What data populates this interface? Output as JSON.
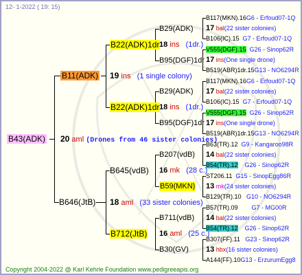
{
  "date_line": "12-   1-2022 (  19:  15)",
  "root": {
    "label": "B43(ADK)",
    "count": "20",
    "unit": "aml",
    "note": "(Drones from 46 sister colonies)"
  },
  "l1_top": {
    "label": "B11(ADK)",
    "count": "19",
    "unit": "ins",
    "note": "(1 single colony)"
  },
  "l1_bot": {
    "label": "B646(JtB)",
    "count": "18",
    "unit": "aml",
    "note": "(33 sister colonies)"
  },
  "l2": [
    {
      "label": "B22(ADK)1dr",
      "count": "18",
      "unit": "ins",
      "note": "(1dr.)"
    },
    {
      "label": "B22(ADK)1dr",
      "count": "18",
      "unit": "ins",
      "note": "(1dr.)"
    },
    {
      "label": "B645(vdB)",
      "count": "16",
      "unit": "mk",
      "note": "(28 c.)"
    },
    {
      "label": "B712(JtB)",
      "count": "16",
      "unit": "aml",
      "note": "(25 c.)"
    }
  ],
  "l3": [
    {
      "label": "B29(ADK)"
    },
    {
      "label": "B95(DGF)1dr"
    },
    {
      "label": "B29(ADK)"
    },
    {
      "label": "B95(DGF)1dr"
    },
    {
      "label": "B207(vdB)"
    },
    {
      "label": "B59(MKN)"
    },
    {
      "label": "B711(vdB)"
    },
    {
      "label": "B30(GV)"
    }
  ],
  "l4": [
    {
      "name": "B117(MKN).16",
      "code": "G6 - Erfoud07-1Q"
    },
    {
      "count": "17",
      "unit": "bal",
      "note": "(22 sister colonies)"
    },
    {
      "name": "B106(IC).15",
      "code": "G7 - Erfoud07-1Q"
    },
    {
      "name": "V555(DGF).15",
      "code": "G26 - Sinop62R"
    },
    {
      "count": "17",
      "unit": "ins",
      "note": "(One single drone)"
    },
    {
      "name": "B519(ABR)1dr.15",
      "code": "G13 - NO6294R"
    },
    {
      "name": "B117(MKN).16",
      "code": "G6 - Erfoud07-1Q"
    },
    {
      "count": "17",
      "unit": "bal",
      "note": "(22 sister colonies)"
    },
    {
      "name": "B106(IC).15",
      "code": "G7 - Erfoud07-1Q"
    },
    {
      "name": "V555(DGF).15",
      "code": "G26 - Sinop62R"
    },
    {
      "count": "17",
      "unit": "ins",
      "note": "(One single drone)"
    },
    {
      "name": "B519(ABR)1dr.15",
      "code": "G13 - NO6294R"
    },
    {
      "name": "B63(TR).12",
      "code": "G9 - Kangaroo98R"
    },
    {
      "count": "14",
      "unit": "bal",
      "note": "(22 sister colonies)"
    },
    {
      "name": "B54(TR).12",
      "code": "G26 - Sinop62R"
    },
    {
      "name": "ST206.11",
      "code": "G15 - SinopEgg86R"
    },
    {
      "count": "13",
      "unit": "mk",
      "note": "(24 sister colonies)"
    },
    {
      "name": "B129(TR).10",
      "code": "G10 - NO6294R"
    },
    {
      "name": "B57(TR).09",
      "code": "G7 - MG00R"
    },
    {
      "count": "14",
      "unit": "bal",
      "note": "(22 sister colonies)"
    },
    {
      "name": "B54(TR).12",
      "code": "G26 - Sinop62R"
    },
    {
      "name": "B307(FF).11",
      "code": "G23 - Sinop62R"
    },
    {
      "count": "13",
      "unit": "hbx",
      "note": "(16 sister colonies)"
    },
    {
      "name": "A144(FF).10",
      "code": "G13 - ErzurumEgg8"
    }
  ],
  "footer": "Copyright 2004-2022 @ Karl Kehrle Foundation     www.pedigreeapis.org"
}
